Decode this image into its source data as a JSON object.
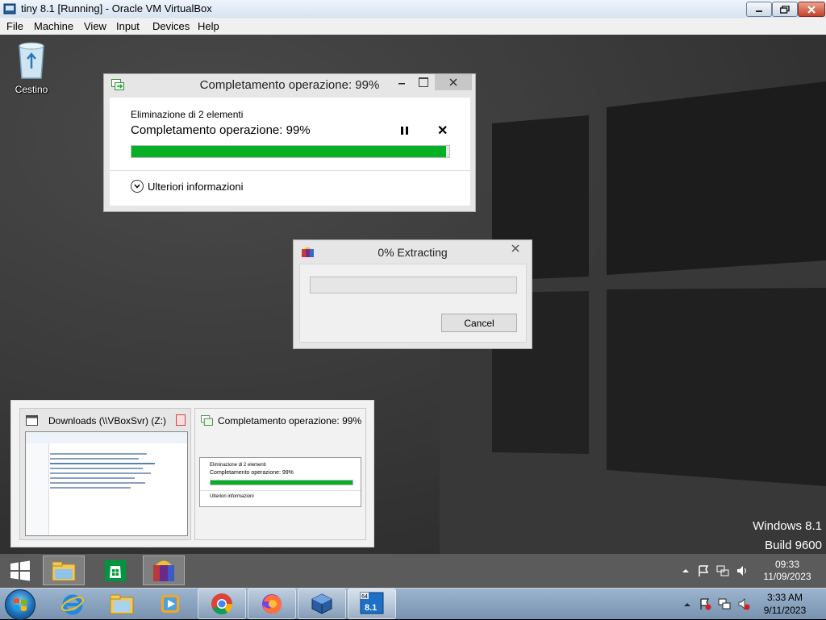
{
  "host": {
    "title": "tiny 8.1 [Running] - Oracle VM VirtualBox",
    "menu": [
      "File",
      "Machine",
      "View",
      "Input",
      "Devices",
      "Help"
    ],
    "controls": {
      "minimize": "minimize",
      "maximize": "restore",
      "close": "close"
    }
  },
  "desktop": {
    "recycle_bin_label": "Cestino",
    "watermark_line1": "Windows 8.1",
    "watermark_line2": "Build 9600"
  },
  "delete_dialog": {
    "title": "Completamento operazione: 99%",
    "subtitle": "Eliminazione di 2 elementi",
    "status": "Completamento operazione: 99%",
    "progress_percent": 99,
    "more_info_label": "Ulteriori informazioni",
    "pause_icon": "pause-icon",
    "cancel_icon": "close-icon",
    "accent": "#06b025"
  },
  "extract_dialog": {
    "title": "0% Extracting",
    "progress_percent": 0,
    "cancel_label": "Cancel",
    "close_symbol": "✕"
  },
  "thumbnails": [
    {
      "title": "Downloads (\\\\VBoxSvr) (Z:)",
      "icon": "explorer-icon"
    },
    {
      "title": "Completamento operazione: 99%",
      "icon": "copy-progress-icon",
      "mini_subtitle": "Eliminazione di 2 elementi",
      "mini_status": "Completamento operazione: 99%",
      "mini_more": "Ulteriori informazioni"
    }
  ],
  "guest_taskbar": {
    "pinned": [
      "file-explorer-icon",
      "store-icon",
      "winrar-icon"
    ],
    "clock_time": "09:33",
    "clock_date": "11/09/2023"
  },
  "host_taskbar": {
    "pinned": [
      "internet-explorer-icon",
      "explorer-icon",
      "media-player-icon",
      "chrome-icon",
      "firefox-icon",
      "virtualbox-icon",
      "vm-81-icon"
    ],
    "vm_badge": "8.1",
    "clock_time": "3:33 AM",
    "clock_date": "9/11/2023"
  }
}
